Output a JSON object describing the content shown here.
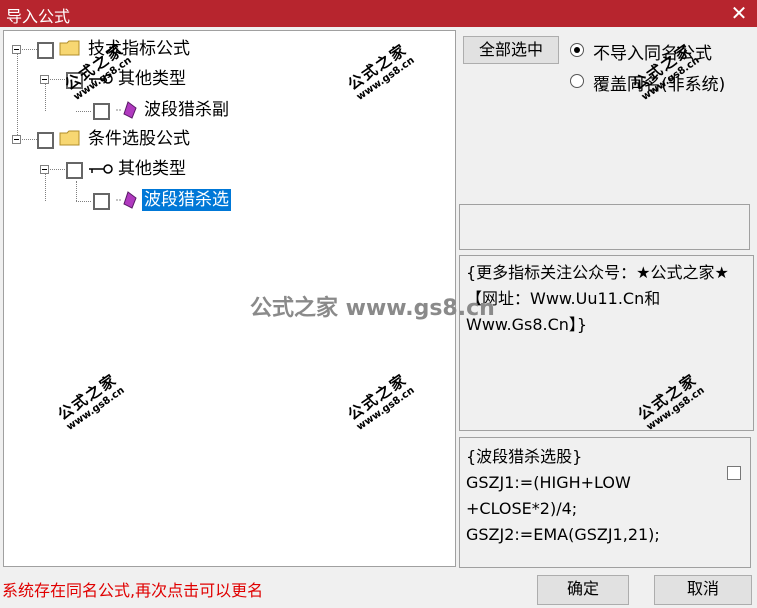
{
  "window": {
    "title": "导入公式",
    "close_glyph": "✕"
  },
  "tree": {
    "nodes": [
      {
        "label": "技术指标公式"
      },
      {
        "label": "其他类型"
      },
      {
        "label": "波段猎杀副"
      },
      {
        "label": "条件选股公式"
      },
      {
        "label": "其他类型"
      },
      {
        "label": "波段猎杀选"
      }
    ]
  },
  "options": {
    "select_all_label": "全部选中",
    "radio_no_import": "不导入同名公式",
    "radio_overwrite": "覆盖同名(非系统)"
  },
  "description": "{更多指标关注公众号：★公式之家★ 【网址：Www.Uu11.Cn和Www.Gs8.Cn】}",
  "code_lines": [
    "{波段猎杀选股}",
    "GSZJ1:=(HIGH+LOW",
    "+CLOSE*2)/4;",
    "GSZJ2:=EMA(GSZJ1,21);"
  ],
  "status_text": "系统存在同名公式,再次点击可以更名",
  "buttons": {
    "ok": "确定",
    "cancel": "取消"
  },
  "watermark": {
    "big": "公式之家",
    "small": "www.gs8.cn",
    "center": "公式之家 www.gs8.cn"
  },
  "colors": {
    "titlebar": "#b7252e",
    "selection": "#0078d7",
    "status": "#e00000"
  }
}
